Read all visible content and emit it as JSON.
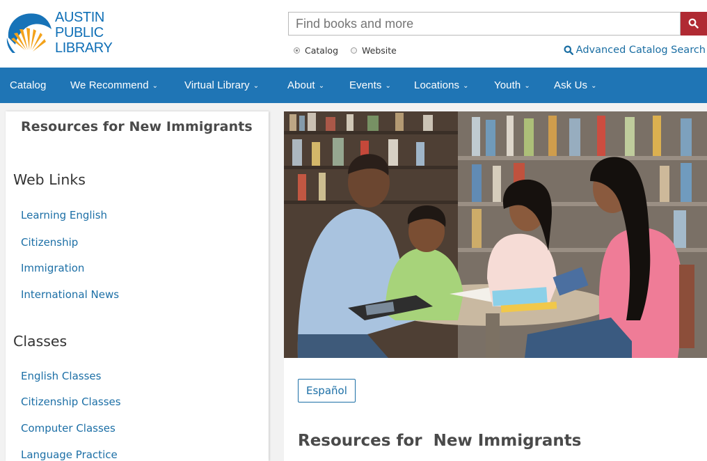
{
  "logo": {
    "line1": "AUSTIN",
    "line2": "PUBLIC",
    "line3": "LIBRARY",
    "icon": "sunburst-logo-icon"
  },
  "search": {
    "placeholder": "Find books and more",
    "button_icon": "search-icon",
    "options": [
      {
        "label": "Catalog",
        "selected": true
      },
      {
        "label": "Website",
        "selected": false
      }
    ],
    "advanced_label": "Advanced Catalog Search"
  },
  "nav": {
    "items": [
      {
        "label": "Catalog",
        "has_dropdown": false
      },
      {
        "label": "We Recommend",
        "has_dropdown": true
      },
      {
        "label": "Virtual Library",
        "has_dropdown": true
      },
      {
        "label": "About",
        "has_dropdown": true
      },
      {
        "label": "Events",
        "has_dropdown": true
      },
      {
        "label": "Locations",
        "has_dropdown": true
      },
      {
        "label": "Youth",
        "has_dropdown": true
      },
      {
        "label": "Ask Us",
        "has_dropdown": true
      }
    ],
    "caret": "⌄"
  },
  "sidebar": {
    "title": "Resources for New Immigrants",
    "sections": [
      {
        "heading": "Web Links",
        "links": [
          "Learning English",
          "Citizenship",
          "Immigration",
          "International News"
        ]
      },
      {
        "heading": "Classes",
        "links": [
          "English Classes",
          "Citizenship Classes",
          "Computer Classes",
          "Language Practice"
        ]
      }
    ]
  },
  "main": {
    "language_button": "Español",
    "title": "Resources for  New Immigrants"
  },
  "colors": {
    "brand_blue": "#1f75b5",
    "link_blue": "#1c6fa6",
    "search_red": "#b02a33",
    "logo_orange": "#f3a21b"
  }
}
